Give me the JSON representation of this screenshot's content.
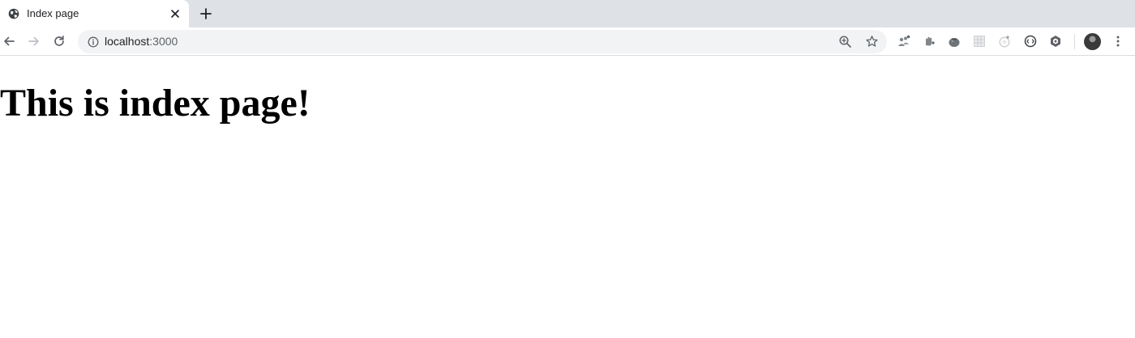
{
  "browser": {
    "tab": {
      "title": "Index page",
      "favicon": "globe-icon"
    },
    "address_bar": {
      "host": "localhost",
      "port": ":3000"
    },
    "extensions": [
      "extension-people-icon",
      "extension-hand-icon",
      "extension-tomato-icon",
      "extension-grid-icon",
      "extension-ring-icon",
      "extension-circle-icon",
      "extension-cube-icon"
    ]
  },
  "page": {
    "heading": "This is index page!"
  },
  "colors": {
    "tabstrip": "#dee1e6",
    "omnibox": "#f1f3f4",
    "icon": "#5f6368",
    "text": "#202124"
  }
}
